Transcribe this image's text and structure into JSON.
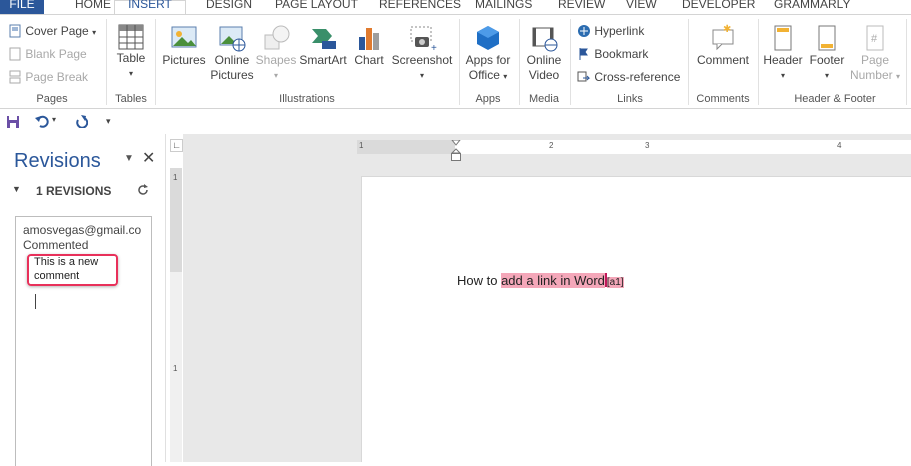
{
  "tabs": [
    "FILE",
    "HOME",
    "INSERT",
    "DESIGN",
    "PAGE LAYOUT",
    "REFERENCES",
    "MAILINGS",
    "REVIEW",
    "VIEW",
    "DEVELOPER",
    "GRAMMARLY"
  ],
  "ribbon": {
    "pages": {
      "cover_page": "Cover Page",
      "blank_page": "Blank Page",
      "page_break": "Page Break",
      "label": "Pages"
    },
    "tables": {
      "table": "Table",
      "label": "Tables"
    },
    "illustrations": {
      "pictures": "Pictures",
      "online_pictures_1": "Online",
      "online_pictures_2": "Pictures",
      "shapes": "Shapes",
      "smartart": "SmartArt",
      "chart": "Chart",
      "screenshot": "Screenshot",
      "label": "Illustrations"
    },
    "apps": {
      "apps_1": "Apps for",
      "apps_2": "Office",
      "label": "Apps"
    },
    "media": {
      "video_1": "Online",
      "video_2": "Video",
      "label": "Media"
    },
    "links": {
      "hyperlink": "Hyperlink",
      "bookmark": "Bookmark",
      "cross_reference": "Cross-reference",
      "label": "Links"
    },
    "comments": {
      "comment": "Comment",
      "label": "Comments"
    },
    "header_footer": {
      "header": "Header",
      "footer": "Footer",
      "page_number_1": "Page",
      "page_number_2": "Number",
      "label": "Header & Footer"
    }
  },
  "revisions": {
    "title": "Revisions",
    "count_label": "1 REVISIONS",
    "author": "amosvegas@gmail.co",
    "action": "Commented",
    "comment_line1": "This is a new",
    "comment_line2": "comment"
  },
  "document": {
    "text_before": "How to ",
    "text_highlight": "add a link in Word",
    "comment_ref": "[a1]"
  },
  "ruler": {
    "ticks": [
      "1",
      "1",
      "2",
      "3",
      "4"
    ]
  },
  "colors": {
    "accent": "#2b579a",
    "highlight": "#f4a7b9",
    "callout": "#e8305a"
  }
}
